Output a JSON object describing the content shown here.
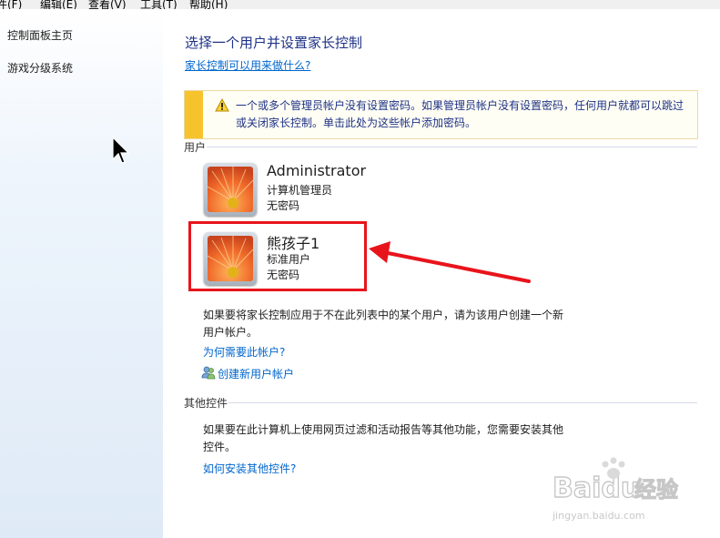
{
  "menubar": {
    "items": [
      "件(F)",
      "编辑(E)",
      "查看(V)",
      "工具(T)",
      "帮助(H)"
    ]
  },
  "sidebar": {
    "items": [
      {
        "label": "控制面板主页"
      },
      {
        "label": "游戏分级系统"
      }
    ]
  },
  "main": {
    "title": "选择一个用户并设置家长控制",
    "help_link": "家长控制可以用来做什么?",
    "warning": {
      "text": "一个或多个管理员帐户没有设置密码。如果管理员帐户没有设置密码，任何用户就都可以跳过或关闭家长控制。单击此处为这些帐户添加密码。"
    },
    "users_section": {
      "label": "用户",
      "users": [
        {
          "name": "Administrator",
          "type": "计算机管理员",
          "password": "无密码"
        },
        {
          "name": "熊孩子1",
          "type": "标准用户",
          "password": "无密码"
        }
      ],
      "info": "如果要将家长控制应用于不在此列表中的某个用户，请为该用户创建一个新用户帐户。",
      "why_link": "为何需要此帐户?",
      "create_link": "创建新用户帐户"
    },
    "other_section": {
      "label": "其他控件",
      "info": "如果要在此计算机上使用网页过滤和活动报告等其他功能，您需要安装其他控件。",
      "install_link": "如何安装其他控件?"
    }
  },
  "watermark": {
    "brand": "Baidu",
    "cn": "经验",
    "url": "jingyan.baidu.com"
  },
  "colors": {
    "title": "#1e3287",
    "link": "#0066cc",
    "warning_bar": "#f7c32d",
    "highlight": "#e8141c"
  }
}
